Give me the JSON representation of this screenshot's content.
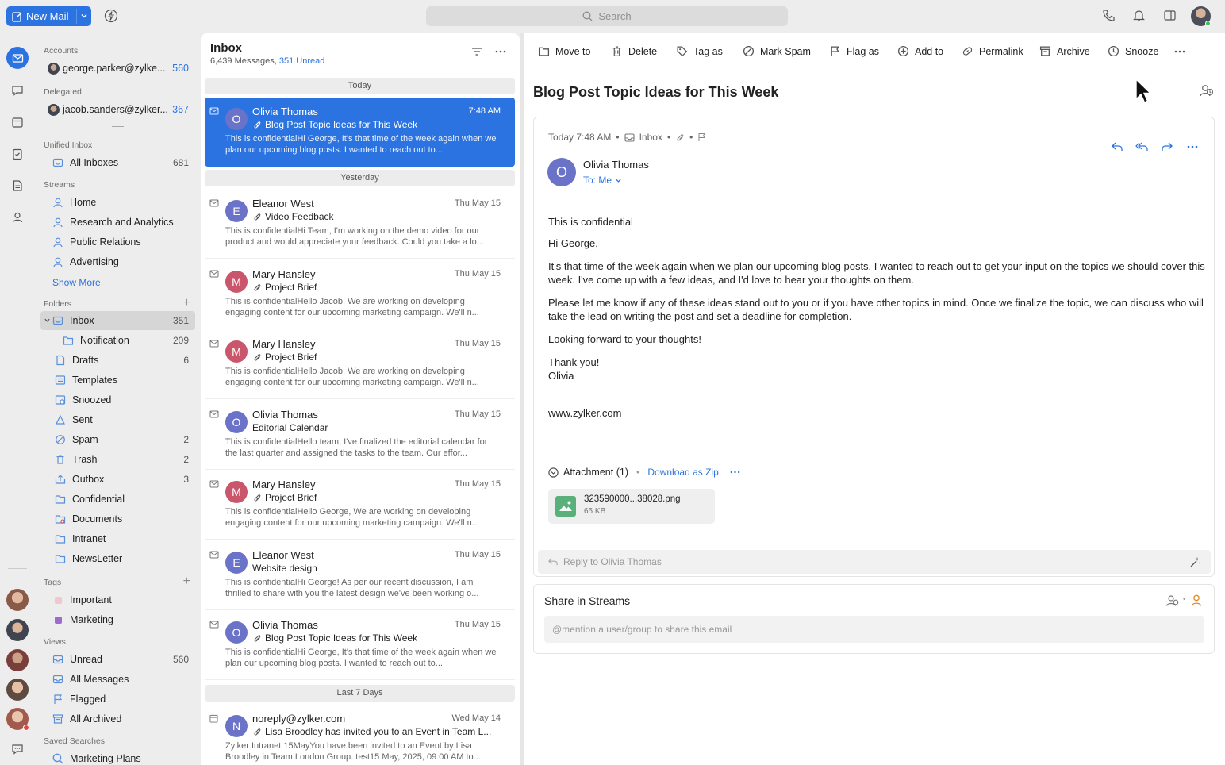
{
  "topbar": {
    "new_mail": "New Mail",
    "search_placeholder": "Search"
  },
  "sidebar": {
    "accounts_heading": "Accounts",
    "account_email": "george.parker@zylke...",
    "account_count": "560",
    "delegated_heading": "Delegated",
    "delegated_email": "jacob.sanders@zylker...",
    "delegated_count": "367",
    "unified_heading": "Unified Inbox",
    "all_inboxes": "All Inboxes",
    "all_inboxes_count": "681",
    "streams_heading": "Streams",
    "streams": [
      "Home",
      "Research and Analytics",
      "Public Relations",
      "Advertising"
    ],
    "show_more": "Show More",
    "folders_heading": "Folders",
    "folders": [
      {
        "name": "Inbox",
        "count": "351"
      },
      {
        "name": "Notification",
        "count": "209"
      },
      {
        "name": "Drafts",
        "count": "6"
      },
      {
        "name": "Templates",
        "count": ""
      },
      {
        "name": "Snoozed",
        "count": ""
      },
      {
        "name": "Sent",
        "count": ""
      },
      {
        "name": "Spam",
        "count": "2"
      },
      {
        "name": "Trash",
        "count": "2"
      },
      {
        "name": "Outbox",
        "count": "3"
      },
      {
        "name": "Confidential",
        "count": ""
      },
      {
        "name": "Documents",
        "count": ""
      },
      {
        "name": "Intranet",
        "count": ""
      },
      {
        "name": "NewsLetter",
        "count": ""
      }
    ],
    "tags_heading": "Tags",
    "tags": [
      {
        "name": "Important",
        "color": "#f3c6cf"
      },
      {
        "name": "Marketing",
        "color": "#a06bcf"
      }
    ],
    "views_heading": "Views",
    "views": [
      {
        "name": "Unread",
        "count": "560"
      },
      {
        "name": "All Messages",
        "count": ""
      },
      {
        "name": "Flagged",
        "count": ""
      },
      {
        "name": "All Archived",
        "count": ""
      }
    ],
    "saved_heading": "Saved Searches",
    "saved": [
      "Marketing Plans"
    ]
  },
  "list": {
    "title": "Inbox",
    "messages_count": "6,439 Messages,",
    "unread": "351 Unread",
    "today": "Today",
    "yesterday": "Yesterday",
    "last7": "Last 7 Days",
    "messages": [
      {
        "initial": "O",
        "color": "#6b73c9",
        "from": "Olivia Thomas",
        "time": "7:48 AM",
        "subject": "Blog Post Topic Ideas for This Week",
        "clip": true,
        "preview": "This is confidentialHi George, It's that time of the week again when we plan our upcoming blog posts. I wanted to reach out to..."
      },
      {
        "initial": "E",
        "color": "#6b73c9",
        "from": "Eleanor West",
        "time": "Thu May 15",
        "subject": "Video Feedback",
        "clip": true,
        "preview": "This is confidentialHi Team, I'm working on the demo video for our product and would appreciate your feedback. Could you take a lo..."
      },
      {
        "initial": "M",
        "color": "#c9566b",
        "from": "Mary Hansley",
        "time": "Thu May 15",
        "subject": "Project Brief",
        "clip": true,
        "preview": "This is confidentialHello Jacob, We are working on developing engaging content for our upcoming marketing campaign. We'll n..."
      },
      {
        "initial": "M",
        "color": "#c9566b",
        "from": "Mary Hansley",
        "time": "Thu May 15",
        "subject": "Project Brief",
        "clip": true,
        "preview": "This is confidentialHello Jacob, We are working on developing engaging content for our upcoming marketing campaign. We'll n..."
      },
      {
        "initial": "O",
        "color": "#6b73c9",
        "from": "Olivia Thomas",
        "time": "Thu May 15",
        "subject": "Editorial Calendar",
        "clip": false,
        "preview": "This is confidentialHello team, I've finalized the editorial calendar for the last quarter and assigned the tasks to the team. Our effor..."
      },
      {
        "initial": "M",
        "color": "#c9566b",
        "from": "Mary Hansley",
        "time": "Thu May 15",
        "subject": "Project Brief",
        "clip": true,
        "preview": "This is confidentialHello George, We are working on developing engaging content for our upcoming marketing campaign. We'll n..."
      },
      {
        "initial": "E",
        "color": "#6b73c9",
        "from": "Eleanor West",
        "time": "Thu May 15",
        "subject": "Website design",
        "clip": false,
        "preview": "This is confidentialHi George! As per our recent discussion, I am thrilled to share with you the latest design we've been working o..."
      },
      {
        "initial": "O",
        "color": "#6b73c9",
        "from": "Olivia Thomas",
        "time": "Thu May 15",
        "subject": "Blog Post Topic Ideas for This Week",
        "clip": true,
        "preview": "This is confidentialHi George, It's that time of the week again when we plan our upcoming blog posts. I wanted to reach out to..."
      },
      {
        "initial": "N",
        "color": "#6b73c9",
        "from": "noreply@zylker.com",
        "time": "Wed May 14",
        "subject": "Lisa Broodley has invited you to an Event in Team L...",
        "clip": true,
        "preview": "Zylker Intranet 15MayYou have been invited to an Event by Lisa Broodley in Team London Group. test15 May, 2025, 09:00 AM to..."
      }
    ]
  },
  "reader": {
    "toolbar": [
      "Move to",
      "Delete",
      "Tag as",
      "Mark Spam",
      "Flag as",
      "Add to",
      "Permalink",
      "Archive",
      "Snooze"
    ],
    "title": "Blog Post Topic Ideas for This Week",
    "meta_time": "Today 7:48 AM",
    "meta_folder": "Inbox",
    "sender_initial": "O",
    "sender": "Olivia Thomas",
    "to": "To: Me",
    "body": [
      "This is confidential",
      "Hi George,",
      "It's that time of the week again when we plan our upcoming blog posts. I wanted to reach out to get your input on the topics we should cover this week. I've come up with a few ideas, and I'd love to hear your thoughts on them.",
      "Please let me know if any of these ideas stand out to you or if you have other topics in mind. Once we finalize the topic, we can discuss who will take the lead on writing the post and set a deadline for completion.",
      "Looking forward to your thoughts!",
      "Thank you!",
      "Olivia",
      "www.zylker.com"
    ],
    "attachment_label": "Attachment (1)",
    "download_zip": "Download as Zip",
    "file_name": "323590000...38028.png",
    "file_size": "65 KB",
    "reply_placeholder": "Reply to Olivia Thomas",
    "share_title": "Share in Streams",
    "mention_placeholder": "@mention a user/group to share this email"
  }
}
